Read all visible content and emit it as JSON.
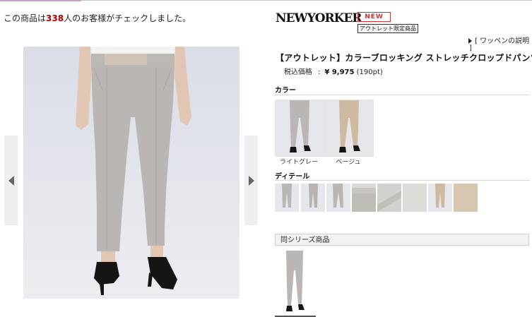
{
  "header": {
    "checked_prefix": "この商品は",
    "checked_count": "338",
    "checked_suffix": "人のお客様がチェックしました。"
  },
  "brand": {
    "logo_text": "NEWYORKER",
    "badge_new": "NEW",
    "badge_outlet": "アウトレット限定商品",
    "wappen_link": "[ ワッペンの説明",
    "wappen_bracket_close": "]"
  },
  "product": {
    "title": "【アウトレット】カラーブロッキング ストレッチクロップドパンツ",
    "price_label": "税込価格",
    "price_colon": ":",
    "price_value": "¥ 9,975",
    "points": "(190pt)"
  },
  "colors": {
    "heading": "カラー",
    "items": [
      {
        "name": "ライトグレー",
        "swatch": "#b9b6b3"
      },
      {
        "name": "ベージュ",
        "swatch": "#cdbaa0"
      }
    ]
  },
  "details": {
    "heading": "ディテール",
    "thumbs": [
      "#bdbab6",
      "#bcb9b5",
      "#bdbab5",
      "#c3c0bb",
      "#cfcdca",
      "#dedcd8",
      "#c9b8a0",
      "#d8c7b0"
    ]
  },
  "series": {
    "heading": "同シリーズ商品"
  },
  "icons": {
    "prev": "chevron-left-icon",
    "next": "chevron-right-icon",
    "wappen": "triangle-right-icon"
  },
  "palette": {
    "accent_red": "#b00000",
    "badge_red": "#cc3333",
    "pants_gray": "#b9b6b3",
    "pants_beige": "#cdbaa0"
  }
}
